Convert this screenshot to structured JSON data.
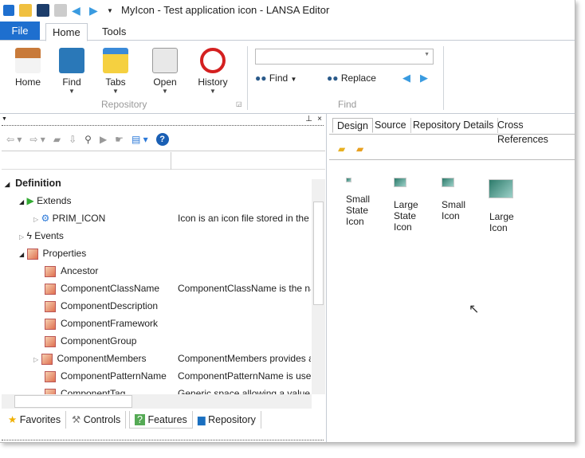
{
  "window": {
    "title": "MyIcon - Test application icon - LANSA Editor"
  },
  "ribbon": {
    "tabs": [
      "File",
      "Home",
      "Tools"
    ],
    "buttons": [
      "Home",
      "Find",
      "Tabs",
      "Open",
      "History"
    ],
    "group_repository": "Repository",
    "group_find": "Find",
    "find_label": "Find",
    "replace_label": "Replace",
    "search_value": ""
  },
  "tree": {
    "items": [
      {
        "label": "Definition",
        "desc": ""
      },
      {
        "label": "Extends",
        "desc": ""
      },
      {
        "label": "PRIM_ICON",
        "desc": "Icon is an icon file stored in the r"
      },
      {
        "label": "Events",
        "desc": ""
      },
      {
        "label": "Properties",
        "desc": ""
      },
      {
        "label": "Ancestor",
        "desc": ""
      },
      {
        "label": "ComponentClassName",
        "desc": "ComponentClassName is the na"
      },
      {
        "label": "ComponentDescription",
        "desc": ""
      },
      {
        "label": "ComponentFramework",
        "desc": ""
      },
      {
        "label": "ComponentGroup",
        "desc": ""
      },
      {
        "label": "ComponentMembers",
        "desc": "ComponentMembers provides a"
      },
      {
        "label": "ComponentPatternName",
        "desc": "ComponentPatternName is used"
      },
      {
        "label": "ComponentTag",
        "desc": "Generic space allowing a value t"
      }
    ]
  },
  "bottom_tabs": [
    "Favorites",
    "Controls",
    "Features",
    "Repository"
  ],
  "design": {
    "tabs": [
      "Design",
      "Source",
      "Repository Details",
      "Cross References"
    ],
    "icons": [
      "Small State Icon",
      "Large State Icon",
      "Small Icon",
      "Large Icon"
    ]
  }
}
